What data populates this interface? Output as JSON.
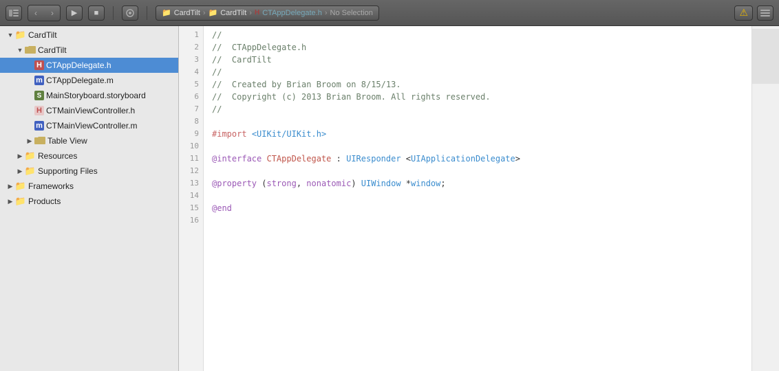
{
  "toolbar": {
    "back_btn": "◀",
    "forward_btn": "▶",
    "breadcrumb": {
      "items": [
        {
          "type": "folder-icon",
          "label": "CardTilt"
        },
        {
          "sep": "›"
        },
        {
          "type": "folder-icon",
          "label": "CardTilt"
        },
        {
          "sep": "›"
        },
        {
          "type": "h-file-icon",
          "label": "CTAppDelegate.h"
        },
        {
          "sep": "›"
        },
        {
          "label": "No Selection"
        }
      ],
      "text": "CardTilt › CardTilt › CTAppDelegate.h › No Selection"
    },
    "warn_label": "",
    "warn_icon": "⚠"
  },
  "toolbar_buttons": [
    "show-hide-nav",
    "back",
    "forward",
    "jump-bar",
    "view-switcher",
    "organizer",
    "breakpoint",
    "scheme",
    "run-stop"
  ],
  "sidebar": {
    "title": "CardTilt",
    "items": [
      {
        "id": "cardtilt-root",
        "label": "CardTilt",
        "level": 0,
        "type": "folder-root",
        "expanded": true,
        "arrow": "▼"
      },
      {
        "id": "cardtilt-group",
        "label": "CardTilt",
        "level": 1,
        "type": "folder-group",
        "expanded": true,
        "arrow": "▼"
      },
      {
        "id": "ctappdelegate-h",
        "label": "CTAppDelegate.h",
        "level": 2,
        "type": "h-file",
        "selected": true
      },
      {
        "id": "ctappdelegate-m",
        "label": "CTAppDelegate.m",
        "level": 2,
        "type": "m-file"
      },
      {
        "id": "mainstoryboard",
        "label": "MainStoryboard.storyboard",
        "level": 2,
        "type": "storyboard"
      },
      {
        "id": "ctmainviewcontroller-h",
        "label": "CTMainViewController.h",
        "level": 2,
        "type": "h-file"
      },
      {
        "id": "ctmainviewcontroller-m",
        "label": "CTMainViewController.m",
        "level": 2,
        "type": "m-file"
      },
      {
        "id": "tableview",
        "label": "Table View",
        "level": 2,
        "type": "folder-group",
        "expanded": false,
        "arrow": "▶"
      },
      {
        "id": "resources",
        "label": "Resources",
        "level": 1,
        "type": "folder",
        "expanded": false,
        "arrow": "▶"
      },
      {
        "id": "supporting-files",
        "label": "Supporting Files",
        "level": 1,
        "type": "folder",
        "expanded": false,
        "arrow": "▶"
      },
      {
        "id": "frameworks",
        "label": "Frameworks",
        "level": 0,
        "type": "folder",
        "expanded": false,
        "arrow": "▶"
      },
      {
        "id": "products",
        "label": "Products",
        "level": 0,
        "type": "folder",
        "expanded": false,
        "arrow": "▶"
      }
    ]
  },
  "editor": {
    "filename": "CTAppDelegate.h",
    "lines": [
      {
        "num": 1,
        "tokens": [
          {
            "class": "c-comment",
            "text": "//"
          }
        ]
      },
      {
        "num": 2,
        "tokens": [
          {
            "class": "c-comment",
            "text": "//  CTAppDelegate.h"
          }
        ]
      },
      {
        "num": 3,
        "tokens": [
          {
            "class": "c-comment",
            "text": "//  CardTilt"
          }
        ]
      },
      {
        "num": 4,
        "tokens": [
          {
            "class": "c-comment",
            "text": "//"
          }
        ]
      },
      {
        "num": 5,
        "tokens": [
          {
            "class": "c-comment",
            "text": "//  Created by Brian Broom on 8/15/13."
          }
        ]
      },
      {
        "num": 6,
        "tokens": [
          {
            "class": "c-comment",
            "text": "//  Copyright (c) 2013 Brian Broom. All rights reserved."
          }
        ]
      },
      {
        "num": 7,
        "tokens": [
          {
            "class": "c-comment",
            "text": "//"
          }
        ]
      },
      {
        "num": 8,
        "tokens": []
      },
      {
        "num": 9,
        "tokens": [
          {
            "class": "c-preprocessor",
            "text": "#import"
          },
          {
            "class": "",
            "text": " "
          },
          {
            "class": "c-system-include",
            "text": "<UIKit/UIKit.h>"
          }
        ]
      },
      {
        "num": 10,
        "tokens": []
      },
      {
        "num": 11,
        "tokens": [
          {
            "class": "c-keyword",
            "text": "@interface"
          },
          {
            "class": "",
            "text": " "
          },
          {
            "class": "c-class",
            "text": "CTAppDelegate"
          },
          {
            "class": "",
            "text": " : "
          },
          {
            "class": "c-protocol",
            "text": "UIResponder"
          },
          {
            "class": "",
            "text": " <"
          },
          {
            "class": "c-protocol",
            "text": "UIApplicationDelegate"
          },
          {
            "class": "",
            "text": ">"
          }
        ]
      },
      {
        "num": 12,
        "tokens": []
      },
      {
        "num": 13,
        "tokens": [
          {
            "class": "c-keyword",
            "text": "@property"
          },
          {
            "class": "",
            "text": " ("
          },
          {
            "class": "c-keyword",
            "text": "strong"
          },
          {
            "class": "",
            "text": ", "
          },
          {
            "class": "c-keyword",
            "text": "nonatomic"
          },
          {
            "class": "",
            "text": ") "
          },
          {
            "class": "c-property-type",
            "text": "UIWindow"
          },
          {
            "class": "",
            "text": " *"
          },
          {
            "class": "c-property-name",
            "text": "window"
          },
          {
            "class": "",
            "text": ";"
          }
        ]
      },
      {
        "num": 14,
        "tokens": []
      },
      {
        "num": 15,
        "tokens": [
          {
            "class": "c-keyword",
            "text": "@end"
          }
        ]
      },
      {
        "num": 16,
        "tokens": []
      }
    ]
  }
}
